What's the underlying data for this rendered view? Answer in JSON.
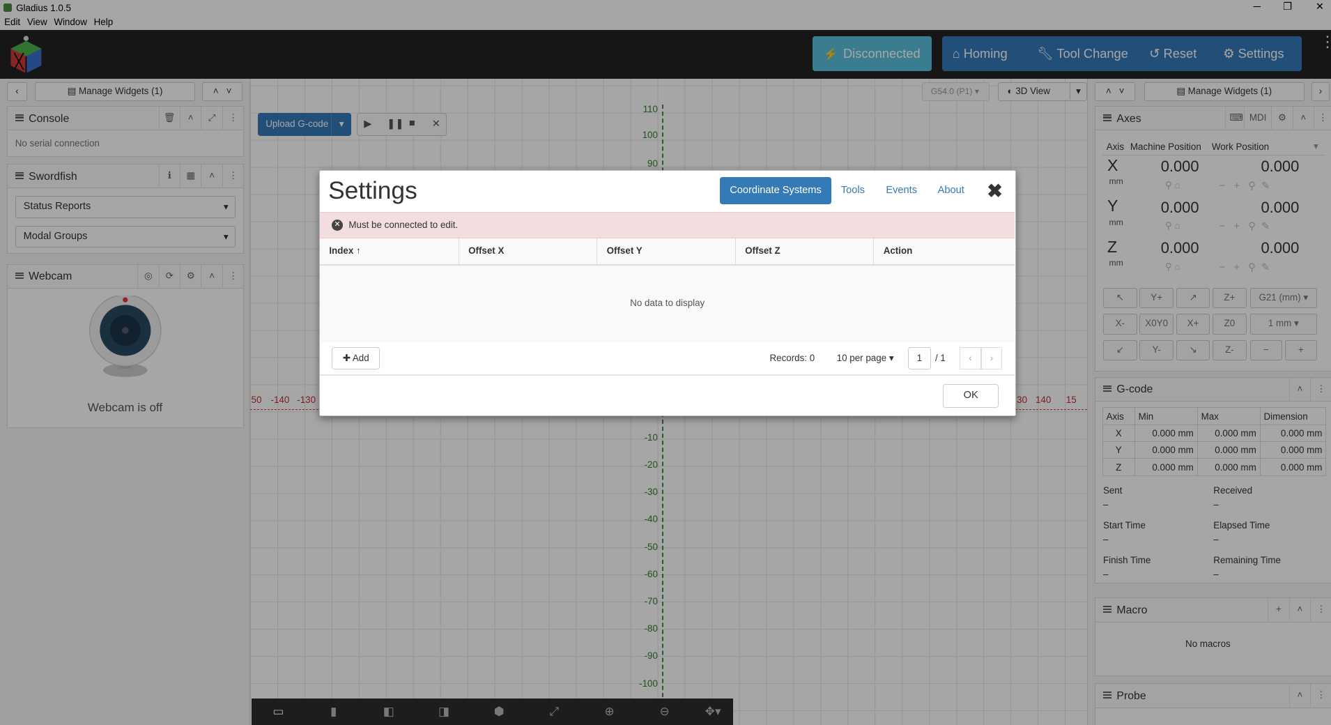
{
  "window": {
    "title": "Gladius 1.0.5",
    "minimize": "─",
    "restore": "❐",
    "close": "✕"
  },
  "menu": [
    "Edit",
    "View",
    "Window",
    "Help"
  ],
  "appbar": {
    "disconnected": "Disconnected",
    "homing": "Homing",
    "tool_change": "Tool Change",
    "reset": "Reset",
    "settings": "Settings"
  },
  "left": {
    "manage_widgets": "Manage Widgets (1)",
    "console": {
      "title": "Console",
      "status": "No serial connection"
    },
    "swordfish": {
      "title": "Swordfish",
      "items": [
        "Status Reports",
        "Modal Groups"
      ]
    },
    "webcam": {
      "title": "Webcam",
      "status": "Webcam is off"
    }
  },
  "center": {
    "upload": "Upload G-code",
    "wcs": "G54.0 (P1)",
    "view": "3D View",
    "y_ticks": [
      "110",
      "100",
      "90",
      "-10",
      "-20",
      "-30",
      "-40",
      "-50",
      "-60",
      "-70",
      "-80",
      "-90",
      "-100"
    ],
    "x_ticks_left": [
      "50",
      "-140",
      "-130"
    ],
    "x_ticks_right": [
      "30",
      "140",
      "15"
    ]
  },
  "modal": {
    "title": "Settings",
    "tabs": [
      "Coordinate Systems",
      "Tools",
      "Events",
      "About"
    ],
    "close": "✖",
    "alert": "Must be connected to edit.",
    "columns": [
      "Index ↑",
      "Offset X",
      "Offset Y",
      "Offset Z",
      "Action"
    ],
    "empty": "No data to display",
    "add": "Add",
    "records": "Records: 0",
    "per_page": "10 per page",
    "page": "1",
    "page_total": "/ 1",
    "ok": "OK"
  },
  "right": {
    "manage_widgets": "Manage Widgets (1)",
    "axes": {
      "title": "Axes",
      "mdi": "MDI",
      "headers": [
        "Axis",
        "Machine Position",
        "Work Position"
      ],
      "rows": [
        {
          "axis": "X",
          "unit": "mm",
          "machine": "0.000",
          "work": "0.000"
        },
        {
          "axis": "Y",
          "unit": "mm",
          "machine": "0.000",
          "work": "0.000"
        },
        {
          "axis": "Z",
          "unit": "mm",
          "machine": "0.000",
          "work": "0.000"
        }
      ],
      "jog": {
        "yplus": "Y+",
        "zplus": "Z+",
        "units": "G21 (mm)",
        "xminus": "X-",
        "xy0": "X0Y0",
        "xplus": "X+",
        "z0": "Z0",
        "step": "1 mm",
        "yminus": "Y-",
        "zminus": "Z-",
        "minus": "−",
        "plus": "+"
      }
    },
    "gcode": {
      "title": "G-code",
      "headers": [
        "Axis",
        "Min",
        "Max",
        "Dimension"
      ],
      "rows": [
        [
          "X",
          "0.000 mm",
          "0.000 mm",
          "0.000 mm"
        ],
        [
          "Y",
          "0.000 mm",
          "0.000 mm",
          "0.000 mm"
        ],
        [
          "Z",
          "0.000 mm",
          "0.000 mm",
          "0.000 mm"
        ]
      ],
      "sent": "Sent",
      "received": "Received",
      "start_time": "Start Time",
      "elapsed_time": "Elapsed Time",
      "finish_time": "Finish Time",
      "remaining_time": "Remaining Time",
      "dash": "–"
    },
    "macro": {
      "title": "Macro",
      "empty": "No macros"
    },
    "probe": {
      "title": "Probe"
    }
  }
}
